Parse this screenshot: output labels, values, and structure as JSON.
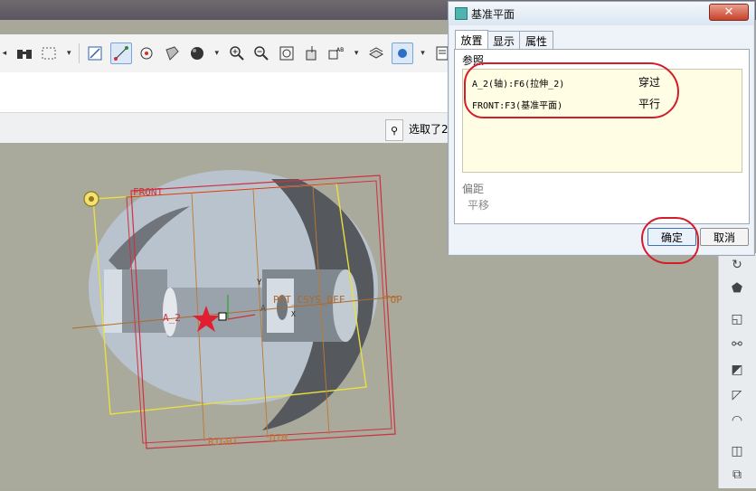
{
  "toolbar": {
    "icons": [
      "binoculars-icon",
      "select-box-icon",
      "dropdown-icon",
      "sketch-icon",
      "spline-icon",
      "circle-icon",
      "shaded-icon",
      "sphere-icon",
      "dropdown-icon",
      "zoom-in-icon",
      "zoom-out-icon",
      "refit-icon",
      "datum-display-icon",
      "annotation-icon",
      "layers-icon",
      "display-style-icon",
      "dropdown-icon",
      "document-icon"
    ]
  },
  "status": {
    "text": "选取了2"
  },
  "dialog": {
    "title": "基准平面",
    "close_glyph": "✕",
    "tabs": [
      {
        "label": "放置",
        "active": true
      },
      {
        "label": "显示",
        "active": false
      },
      {
        "label": "属性",
        "active": false
      }
    ],
    "references_label": "参照",
    "references": [
      {
        "ref": "A_2(轴):F6(拉伸_2)",
        "type": "穿过"
      },
      {
        "ref": "FRONT:F3(基准平面)",
        "type": "平行"
      }
    ],
    "offset_label": "偏距",
    "offset_value": "平移",
    "ok_label": "确定",
    "cancel_label": "取消"
  },
  "viewport": {
    "labels": {
      "front": "FRONT",
      "axis": "A_2",
      "csys": "PRT_CSYS_DEF",
      "top": "TOP",
      "right": "RIGHT",
      "dim": "DIM",
      "axis_a": "A",
      "y": "Y",
      "x": "X"
    }
  },
  "right_tools": {
    "icons": [
      "revolve-icon",
      "blend-icon",
      "shell-icon",
      "draft-icon",
      "rib-icon",
      "sweep-icon",
      "surface-icon",
      "round-icon",
      "mirror-icon",
      "pattern-icon"
    ]
  },
  "colors": {
    "annotation": "#d41c2b",
    "datum_plane": "#d03040",
    "selected_plane": "#e8e040",
    "viewport_bg": "#a9aa9c"
  }
}
